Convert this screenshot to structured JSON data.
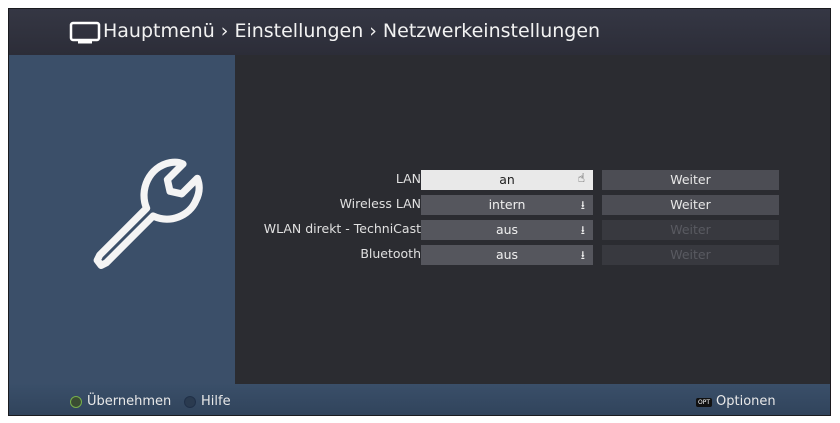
{
  "header": {
    "icon": "tv-icon",
    "breadcrumb": "Hauptmenü › Einstellungen › Netzwerkeinstellungen"
  },
  "side": {
    "icon": "wrench-icon"
  },
  "settings": [
    {
      "label": "LAN",
      "value": "an",
      "value_icon": "hand-pointer-icon",
      "selected": true,
      "button": "Weiter",
      "button_enabled": true
    },
    {
      "label": "Wireless LAN",
      "value": "intern",
      "value_icon": "arrow-down-icon",
      "selected": false,
      "button": "Weiter",
      "button_enabled": true
    },
    {
      "label": "WLAN direkt - TechniCast",
      "value": "aus",
      "value_icon": "arrow-down-icon",
      "selected": false,
      "button": "Weiter",
      "button_enabled": false
    },
    {
      "label": "Bluetooth",
      "value": "aus",
      "value_icon": "arrow-down-icon",
      "selected": false,
      "button": "Weiter",
      "button_enabled": false
    }
  ],
  "footer": {
    "green_label": "Übernehmen",
    "blue_label": "Hilfe",
    "opt_badge": "OPT",
    "options_label": "Optionen"
  },
  "colors": {
    "background": "#2b2c31",
    "side_panel": "#3b4f69",
    "selected_field": "#e9e9e9",
    "green_button": "#77b04a"
  }
}
